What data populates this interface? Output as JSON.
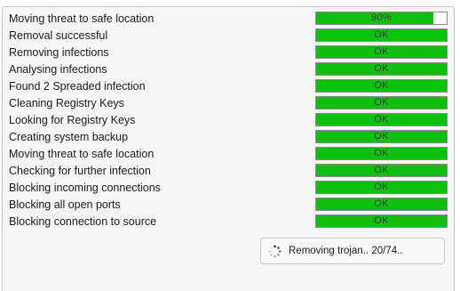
{
  "tasks": [
    {
      "label": "Moving threat to safe location",
      "status": "90%",
      "progress": 0.9
    },
    {
      "label": "Removal successful",
      "status": "OK",
      "progress": 1
    },
    {
      "label": "Removing infections",
      "status": "OK",
      "progress": 1
    },
    {
      "label": "Analysing infections",
      "status": "OK",
      "progress": 1
    },
    {
      "label": "Found 2 Spreaded infection",
      "status": "OK",
      "progress": 1
    },
    {
      "label": "Cleaning Registry Keys",
      "status": "OK",
      "progress": 1
    },
    {
      "label": "Looking for Registry Keys",
      "status": "OK",
      "progress": 1
    },
    {
      "label": "Creating system backup",
      "status": "OK",
      "progress": 1
    },
    {
      "label": "Moving threat to safe location",
      "status": "OK",
      "progress": 1
    },
    {
      "label": "Checking for further infection",
      "status": "OK",
      "progress": 1
    },
    {
      "label": "Blocking incoming connections",
      "status": "OK",
      "progress": 1
    },
    {
      "label": "Blocking all open ports",
      "status": "OK",
      "progress": 1
    },
    {
      "label": "Blocking connection to source",
      "status": "OK",
      "progress": 1
    }
  ],
  "status_box": {
    "text": "Removing trojan.. 20/74..",
    "icon": "loading-spinner-icon"
  },
  "colors": {
    "bar_fill": "#0dc00d",
    "bar_border": "#8a8a8a",
    "panel_background": "#f6f6f6"
  }
}
